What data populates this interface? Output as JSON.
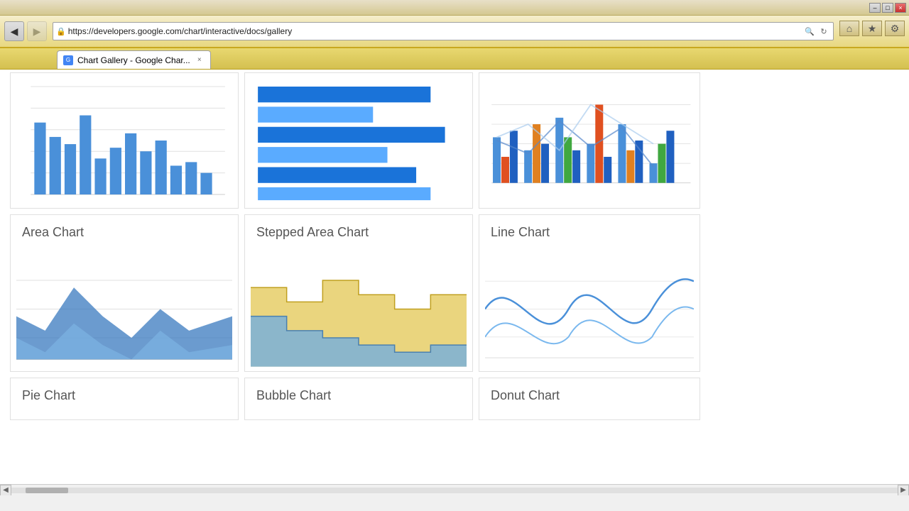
{
  "browser": {
    "title": "Chart Gallery - Google Char...",
    "url": "https://developers.google.com/chart/interactive/docs/gallery",
    "back_btn": "◀",
    "forward_btn": "▶",
    "back_disabled": false,
    "forward_disabled": true,
    "tab_label": "Chart Gallery - Google Char...",
    "tab_close": "×",
    "home_icon": "⌂",
    "star_icon": "★",
    "wrench_icon": "🔧",
    "min_btn": "–",
    "max_btn": "□",
    "close_btn": "×",
    "lock_icon": "🔒",
    "search_icon": "🔍",
    "refresh_icon": "↻"
  },
  "gallery": {
    "charts": [
      {
        "id": "column-chart",
        "title": "",
        "type": "column"
      },
      {
        "id": "bar-chart",
        "title": "",
        "type": "hbar"
      },
      {
        "id": "combo-chart",
        "title": "",
        "type": "combo"
      },
      {
        "id": "area-chart",
        "title": "Area Chart",
        "type": "area"
      },
      {
        "id": "stepped-area-chart",
        "title": "Stepped Area Chart",
        "type": "stepped"
      },
      {
        "id": "line-chart",
        "title": "Line Chart",
        "type": "line"
      },
      {
        "id": "pie-chart",
        "title": "Pie Chart",
        "type": "pie"
      },
      {
        "id": "bubble-chart",
        "title": "Bubble Chart",
        "type": "bubble"
      },
      {
        "id": "donut-chart",
        "title": "Donut Chart",
        "type": "donut"
      }
    ]
  }
}
